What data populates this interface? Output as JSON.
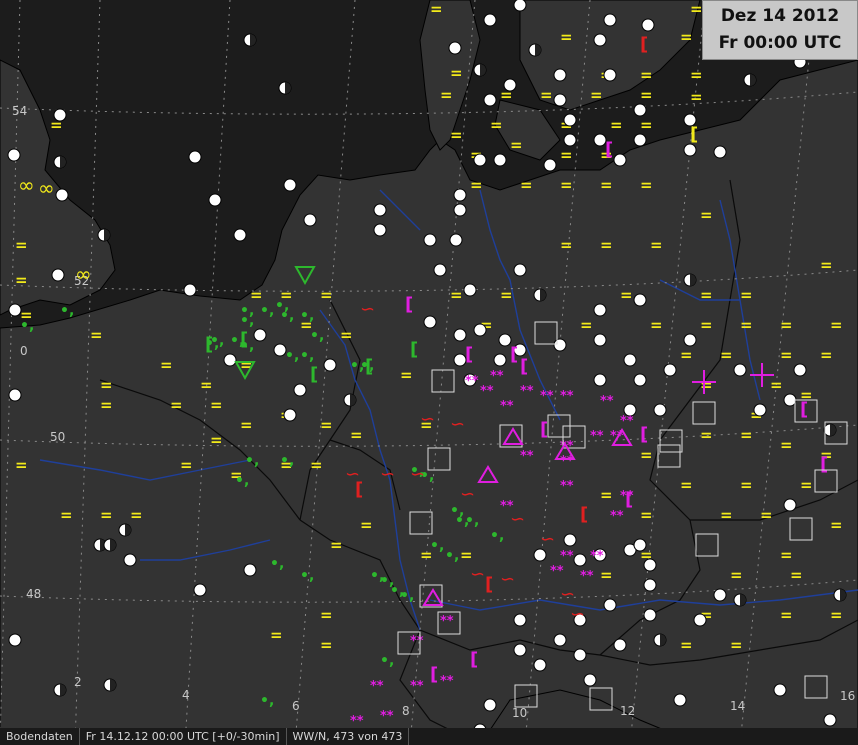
{
  "header": {
    "date": "Dez 14 2012",
    "time": "Fr 00:00 UTC"
  },
  "axis_labels": {
    "lat": [
      {
        "label": "54"
      },
      {
        "label": "52"
      },
      {
        "label": "50"
      },
      {
        "label": "48"
      }
    ],
    "lon": [
      {
        "label": "0"
      },
      {
        "label": "2"
      },
      {
        "label": "4"
      },
      {
        "label": "6"
      },
      {
        "label": "8"
      },
      {
        "label": "10"
      },
      {
        "label": "12"
      },
      {
        "label": "14"
      },
      {
        "label": "16"
      }
    ]
  },
  "statusbar": {
    "source": "Bodendaten",
    "timestamp": "Fr 14.12.12 00:00 UTC [+0/-30min]",
    "count": "WW/N, 473 von 473"
  },
  "colors": {
    "sea": "#1b1b1b",
    "land": "#333333",
    "fog_mist": "#f2ea1a",
    "drizzle_rain": "#2db82d",
    "snow": "#e01ee0",
    "freezing": "#e02020",
    "river": "#1f3f9a",
    "station": "#ffffff"
  },
  "symbols": {
    "fog_mist": "=",
    "drizzle": "•,",
    "snow": "*",
    "freezing_rain": "∽",
    "thunder": "[",
    "haze": "∞"
  }
}
